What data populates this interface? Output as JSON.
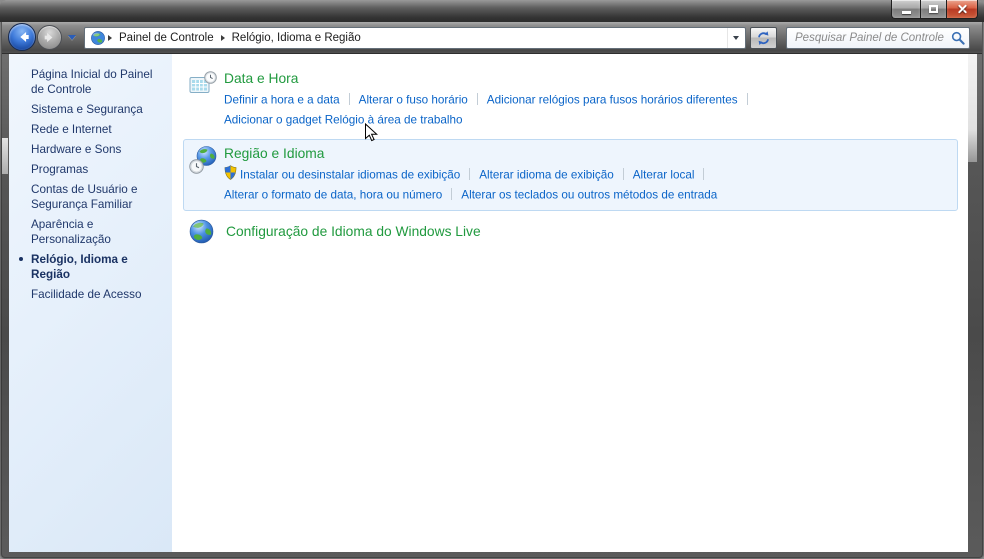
{
  "navbar": {
    "breadcrumb": [
      "Painel de Controle",
      "Relógio, Idioma e Região"
    ],
    "search_placeholder": "Pesquisar Painel de Controle"
  },
  "sidebar": {
    "items": [
      {
        "label": "Página Inicial do Painel de Controle",
        "active": false
      },
      {
        "label": "Sistema e Segurança",
        "active": false
      },
      {
        "label": "Rede e Internet",
        "active": false
      },
      {
        "label": "Hardware e Sons",
        "active": false
      },
      {
        "label": "Programas",
        "active": false
      },
      {
        "label": "Contas de Usuário e Segurança Familiar",
        "active": false
      },
      {
        "label": "Aparência e Personalização",
        "active": false
      },
      {
        "label": "Relógio, Idioma e Região",
        "active": true
      },
      {
        "label": "Facilidade de Acesso",
        "active": false
      }
    ]
  },
  "main": {
    "groups": [
      {
        "title": "Data e Hora",
        "icon": "calendar-clock-icon",
        "highlighted": false,
        "link_lines": [
          {
            "links": [
              {
                "label": "Definir a hora e a data"
              },
              {
                "label": "Alterar o fuso horário"
              },
              {
                "label": "Adicionar relógios para fusos horários diferentes"
              }
            ],
            "trailing_separator": true
          },
          {
            "links": [
              {
                "label": "Adicionar o gadget Relógio à área de trabalho"
              }
            ],
            "trailing_separator": false
          }
        ]
      },
      {
        "title": "Região e Idioma",
        "icon": "globe-clock-icon",
        "highlighted": true,
        "link_lines": [
          {
            "links": [
              {
                "label": "Instalar ou desinstalar idiomas de exibição",
                "shield": true
              },
              {
                "label": "Alterar idioma de exibição"
              },
              {
                "label": "Alterar local"
              }
            ],
            "trailing_separator": true
          },
          {
            "links": [
              {
                "label": "Alterar o formato de data, hora ou número"
              },
              {
                "label": "Alterar os teclados ou outros métodos de entrada"
              }
            ],
            "trailing_separator": false
          }
        ]
      },
      {
        "title": "Configuração de Idioma do Windows Live",
        "icon": "globe-icon",
        "highlighted": false,
        "link_lines": []
      }
    ]
  },
  "colors": {
    "category_green": "#219a3f",
    "link_blue": "#0a64c8",
    "sidebar_bg": "#e7f0fb",
    "highlight_bg": "#eef5fd",
    "highlight_border": "#bed9f2",
    "close_button_red": "#c74634"
  }
}
